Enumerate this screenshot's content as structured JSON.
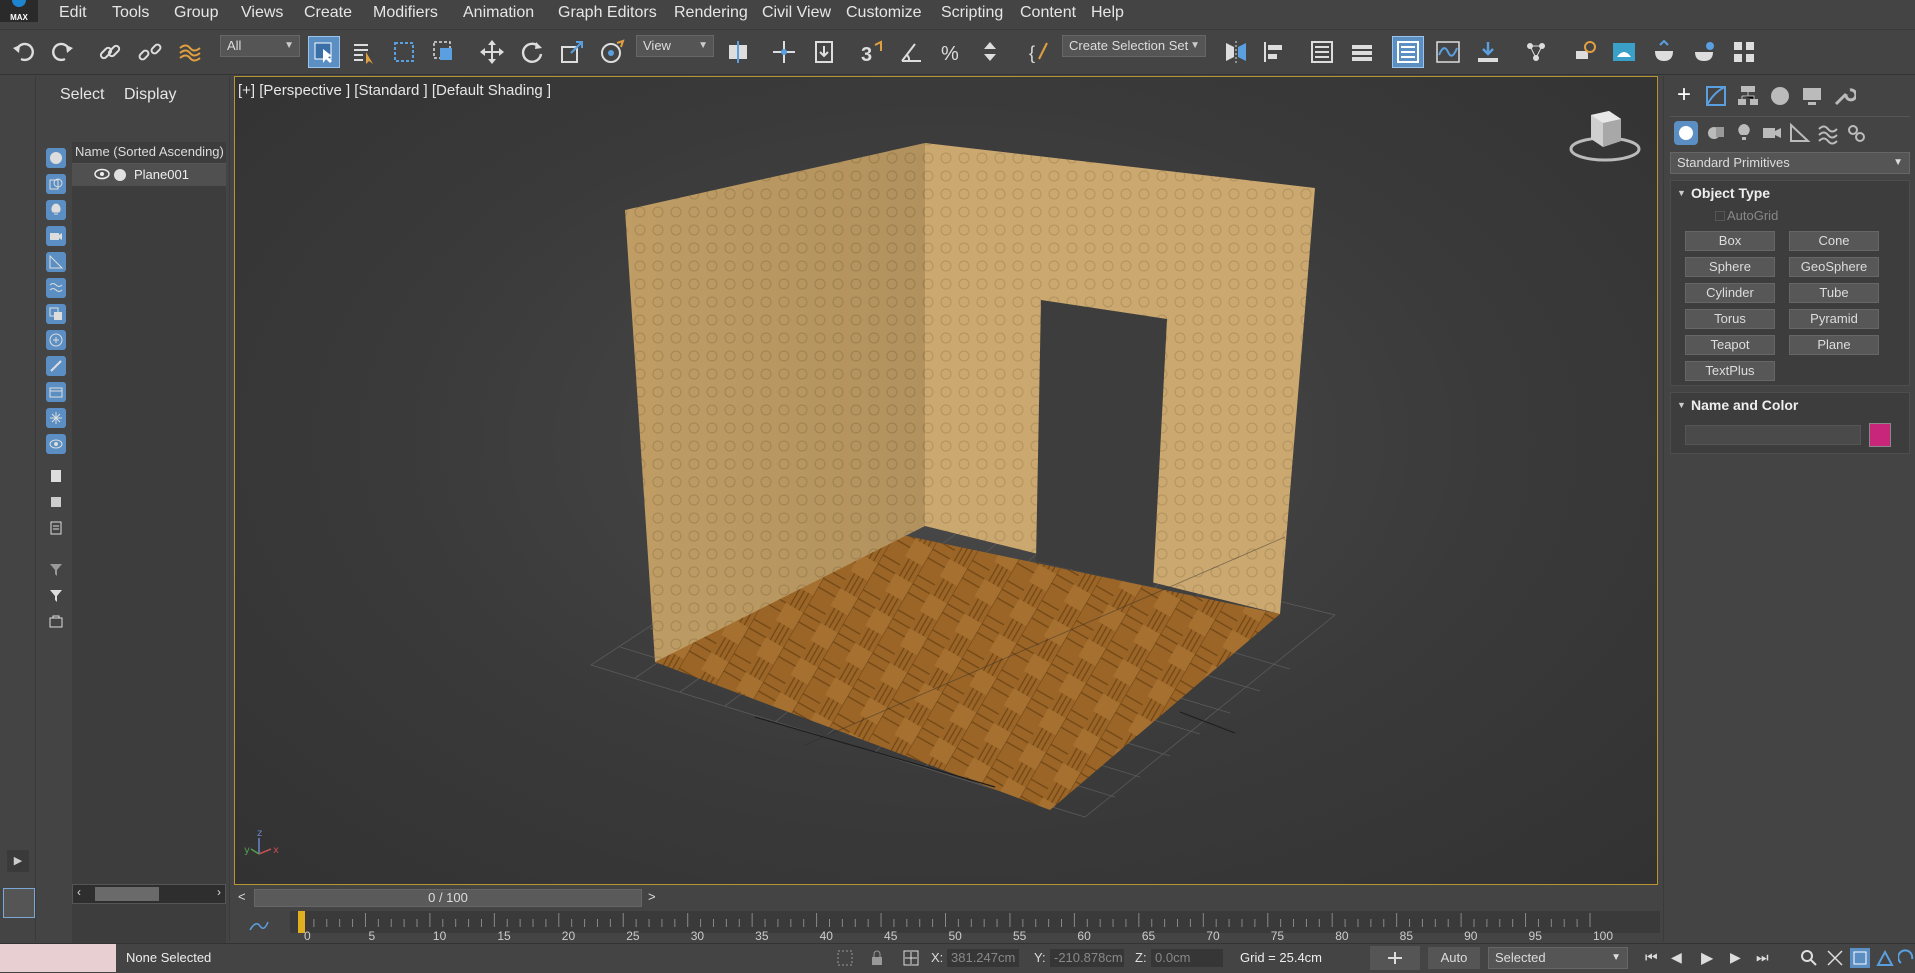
{
  "app": {
    "logo_text": "MAX"
  },
  "menu": [
    "Edit",
    "Tools",
    "Group",
    "Views",
    "Create",
    "Modifiers",
    "Animation",
    "Graph Editors",
    "Rendering",
    "Civil View",
    "Customize",
    "Scripting",
    "Content",
    "Help"
  ],
  "toolbar": {
    "filter_value": "All",
    "view_value": "View",
    "selection_set_value": "Create Selection Set"
  },
  "scene_explorer": {
    "tab_select": "Select",
    "tab_display": "Display",
    "column_header": "Name (Sorted Ascending)",
    "objects": [
      {
        "name": "Plane001"
      }
    ]
  },
  "viewport": {
    "label": "[+] [Perspective ] [Standard ] [Default Shading ]"
  },
  "command_panel": {
    "category_value": "Standard Primitives",
    "object_type_title": "Object Type",
    "autogrid_label": "AutoGrid",
    "buttons": [
      "Box",
      "Cone",
      "Sphere",
      "GeoSphere",
      "Cylinder",
      "Tube",
      "Torus",
      "Pyramid",
      "Teapot",
      "Plane",
      "TextPlus"
    ],
    "name_color_title": "Name and Color",
    "object_color": "#c8267a"
  },
  "timeline": {
    "frame_display": "0 / 100",
    "prev_label": "<",
    "next_label": ">",
    "ticks": [
      "0",
      "5",
      "10",
      "15",
      "20",
      "25",
      "30",
      "35",
      "40",
      "45",
      "50",
      "55",
      "60",
      "65",
      "70",
      "75",
      "80",
      "85",
      "90",
      "95",
      "100"
    ]
  },
  "status": {
    "selection_text": "None Selected",
    "x_label": "X:",
    "x_value": "381.247cm",
    "y_label": "Y:",
    "y_value": "-210.878cm",
    "z_label": "Z:",
    "z_value": "0.0cm",
    "grid_text": "Grid = 25.4cm",
    "auto_label": "Auto",
    "selected_filter": "Selected"
  },
  "colors": {
    "accent": "#5b8fc4",
    "viewport_border": "#b89432",
    "wall": "#c9a56a",
    "floor": "#a86e2a"
  }
}
